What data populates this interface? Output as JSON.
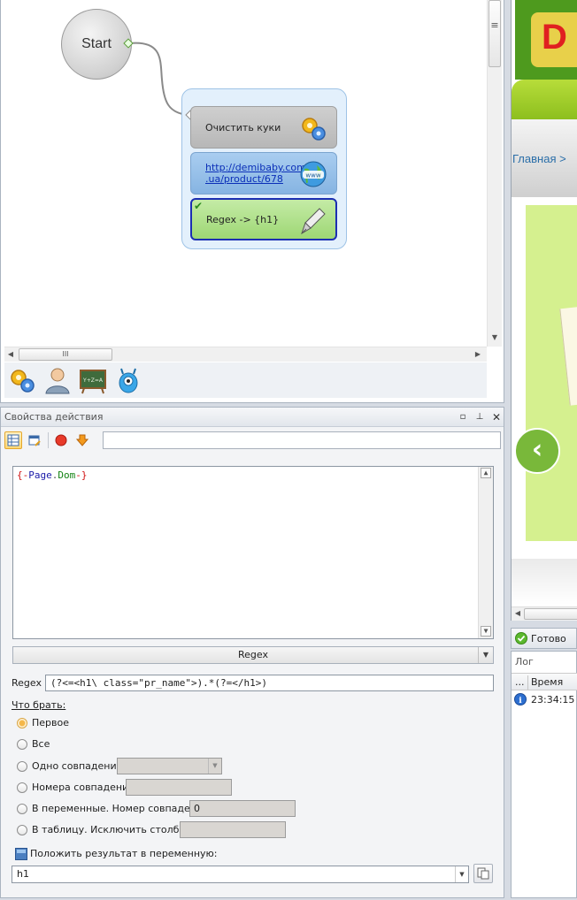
{
  "canvas": {
    "start_label": "Start",
    "actions": [
      {
        "label": "Очистить куки"
      },
      {
        "label": "http://demibaby.com.ua/product/678",
        "line1": "http://demibaby.com",
        "line2": ".ua/product/678"
      },
      {
        "label": "Regex -> {h1}"
      }
    ],
    "hscroll_thumb_glyph": "III",
    "vscroll_thumb_glyph": "≡"
  },
  "props": {
    "title": "Свойства действия",
    "code_text_parts": [
      "{-",
      "Page",
      ".",
      "Dom",
      "-}"
    ],
    "action_type": "Regex",
    "regex_label": "Regex",
    "regex_value": "(?<=<h1\\ class=\"pr_name\">).*(?=</h1>)",
    "what_take_label": "Что брать:",
    "options": {
      "first": "Первое",
      "all": "Все",
      "one_match": "Одно совпадение",
      "match_numbers": "Номера совпадений",
      "to_vars": "В переменные. Номер совпадения",
      "to_vars_value": "0",
      "to_table": "В таблицу. Исключить столбцы"
    },
    "save_result_label": "Положить результат в переменную:",
    "result_var": "h1"
  },
  "browser": {
    "breadcrumb": "Главная  >",
    "back_glyph": "‹"
  },
  "status": {
    "text": "Готово"
  },
  "log": {
    "title": "Лог",
    "col_dots": "...",
    "col_time": "Время",
    "rows": [
      {
        "time": "23:34:15"
      }
    ]
  },
  "colors": {
    "selected_border": "#1c2eb2",
    "code_brace": "#d01010",
    "code_obj": "#1a1aa8",
    "code_prop": "#128212"
  }
}
